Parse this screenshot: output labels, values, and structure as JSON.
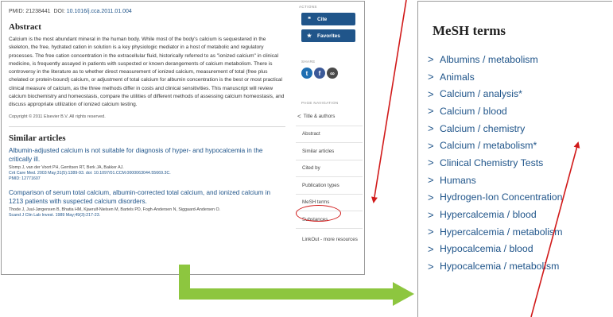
{
  "article": {
    "pmid": "PMID: 21238441",
    "doi_label": "DOI:",
    "doi": "10.1016/j.cca.2011.01.004",
    "abstract_heading": "Abstract",
    "abstract": "Calcium is the most abundant mineral in the human body. While most of the body's calcium is sequestered in the skeleton, the free, hydrated cation in solution is a key physiologic mediator in a host of metabolic and regulatory processes. The free cation concentration in the extracellular fluid, historically referred to as \"ionized calcium\" in clinical medicine, is frequently assayed in patients with suspected or known derangements of calcium metabolism. There is controversy in the literature as to whether direct measurement of ionized calcium, measurement of total (free plus chelated or protein-bound) calcium, or adjustment of total calcium for albumin concentration is the best or most practical clinical measure of calcium, as the three methods differ in costs and clinical sensitivities. This manuscript will review calcium biochemistry and homeostasis, compare the utilities of different methods of assessing calcium homeostasis, and discuss appropriate utilization of ionized calcium testing.",
    "copyright": "Copyright © 2011 Elsevier B.V. All rights reserved."
  },
  "similar": {
    "heading": "Similar articles",
    "items": [
      {
        "title": "Albumin-adjusted calcium is not suitable for diagnosis of hyper- and hypocalcemia in the critically ill.",
        "authors": "Slomp J, van der Voort PH, Gerritsen RT, Berk JA, Bakker AJ.",
        "citation": "Crit Care Med. 2003 May;31(5):1389-93. doi: 10.1097/01.CCM.0000063044.55669.3C.",
        "pmid": "PMID: 12771607"
      },
      {
        "title": "Comparison of serum total calcium, albumin-corrected total calcium, and ionized calcium in 1213 patients with suspected calcium disorders.",
        "authors": "Thode J, Juul-Jørgensen B, Bhatia HM, Kjaerulf-Nielsen M, Bartels PD, Fogh-Andersen N, Siggaard-Andersen O.",
        "citation": "Scand J Clin Lab Invest. 1989 May;49(3):217-23.",
        "pmid": ""
      }
    ]
  },
  "sidebar": {
    "actions_label": "ACTIONS",
    "cite_label": "Cite",
    "favorites_label": "Favorites",
    "share_label": "SHARE",
    "page_nav_label": "PAGE NAVIGATION",
    "nav": {
      "title_authors": "Title & authors",
      "abstract": "Abstract",
      "similar": "Similar articles",
      "cited_by": "Cited by",
      "pub_types": "Publication types",
      "mesh": "MeSH terms",
      "substances": "Substances",
      "linkout": "LinkOut - more resources"
    }
  },
  "mesh": {
    "title": "MeSH terms",
    "terms": [
      "Albumins / metabolism",
      "Animals",
      "Calcium / analysis*",
      "Calcium / blood",
      "Calcium / chemistry",
      "Calcium / metabolism*",
      "Clinical Chemistry Tests",
      "Humans",
      "Hydrogen-Ion Concentration",
      "Hypercalcemia / blood",
      "Hypercalcemia / metabolism",
      "Hypocalcemia / blood",
      "Hypocalcemia / metabolism"
    ]
  },
  "colors": {
    "link_blue": "#20558a",
    "annotation_red": "#d11a1a",
    "arrow_green": "#8dc63f"
  },
  "icons": [
    "quote-icon",
    "star-icon",
    "twitter-icon",
    "facebook-icon",
    "permalink-icon",
    "chevron-left-icon",
    "chevron-right-icon"
  ]
}
